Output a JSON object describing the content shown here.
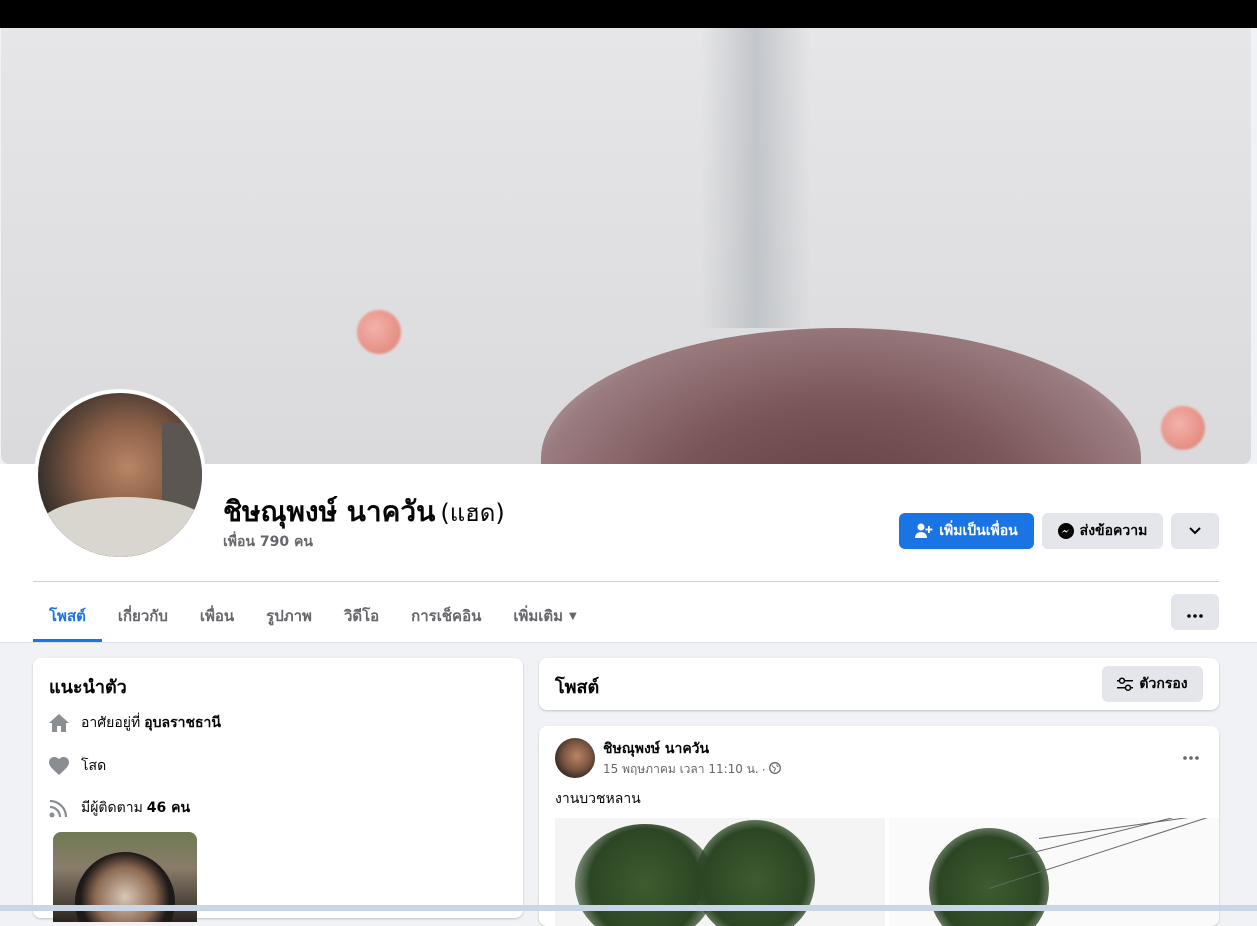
{
  "profile": {
    "name": "ชิษณุพงษ์ นาควัน",
    "nickname": "(แฮด)",
    "friends_count": "เพื่อน 790 คน"
  },
  "actions": {
    "add_friend": "เพิ่มเป็นเพื่อน",
    "message": "ส่งข้อความ"
  },
  "tabs": [
    {
      "label": "โพสต์",
      "active": true
    },
    {
      "label": "เกี่ยวกับ"
    },
    {
      "label": "เพื่อน"
    },
    {
      "label": "รูปภาพ"
    },
    {
      "label": "วิดีโอ"
    },
    {
      "label": "การเช็คอิน"
    },
    {
      "label": "เพิ่มเติม"
    }
  ],
  "intro": {
    "title": "แนะนำตัว",
    "lives_prefix": "อาศัยอยู่ที่",
    "lives_value": "อุบลราชธานี",
    "relationship": "โสด",
    "followers_prefix": "มีผู้ติดตาม",
    "followers_value": "46 คน"
  },
  "posts": {
    "title": "โพสต์",
    "filter_label": "ตัวกรอง",
    "items": [
      {
        "author": "ชิษณุพงษ์ นาควัน",
        "timestamp": "15 พฤษภาคม เวลา 11:10 น.",
        "text": "งานบวชหลาน"
      }
    ]
  },
  "colors": {
    "accent": "#1b74e4",
    "secondary_button": "#e4e6eb",
    "page_bg": "#f0f2f5"
  }
}
